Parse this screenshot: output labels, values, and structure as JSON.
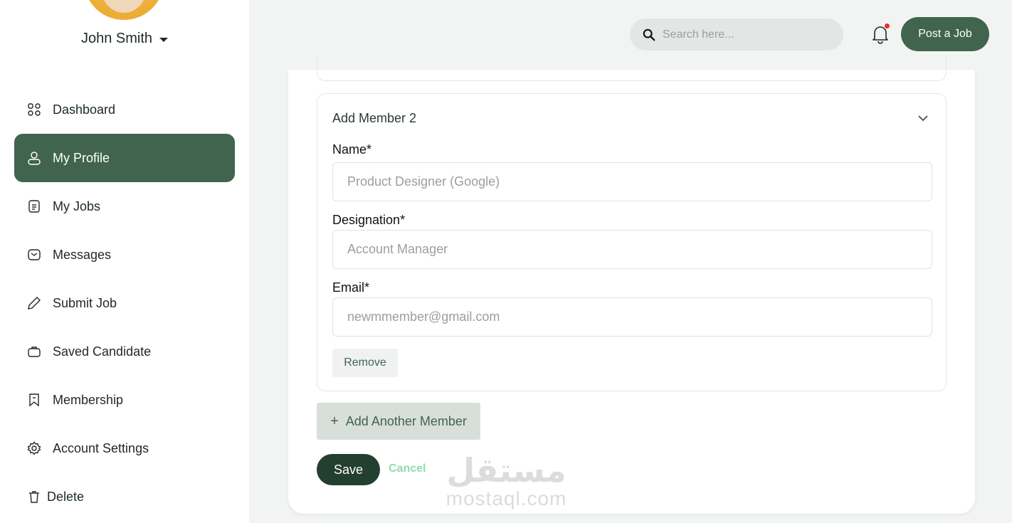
{
  "user": {
    "name": "John Smith"
  },
  "sidebar": {
    "items": [
      {
        "label": "Dashboard",
        "icon": "grid-icon"
      },
      {
        "label": "My Profile",
        "icon": "user-icon",
        "active": true
      },
      {
        "label": "My Jobs",
        "icon": "document-icon"
      },
      {
        "label": "Messages",
        "icon": "mail-icon"
      },
      {
        "label": "Submit Job",
        "icon": "pencil-icon"
      },
      {
        "label": "Saved Candidate",
        "icon": "briefcase-icon"
      },
      {
        "label": "Membership",
        "icon": "bookmark-icon"
      },
      {
        "label": "Account Settings",
        "icon": "gear-icon"
      },
      {
        "label": "Delete",
        "icon": "trash-icon"
      }
    ]
  },
  "header": {
    "search_placeholder": "Search here...",
    "post_job_label": "Post a Job"
  },
  "member_form": {
    "title": "Add Member 2",
    "name_label": "Name*",
    "name_placeholder": "Product Designer (Google)",
    "designation_label": "Designation*",
    "designation_placeholder": "Account Manager",
    "email_label": "Email*",
    "email_placeholder": "newmmember@gmail.com",
    "remove_label": "Remove"
  },
  "actions": {
    "add_member_plus": "+",
    "add_member_label": "Add Another Member",
    "save_label": "Save",
    "cancel_label": "Cancel"
  },
  "watermark": {
    "arabic": "مستقل",
    "latin": "mostaql.com"
  },
  "colors": {
    "primary": "#41644e",
    "dark": "#233f2f",
    "cancel": "#8fdcb0",
    "notification_dot": "#ef2b2b"
  }
}
